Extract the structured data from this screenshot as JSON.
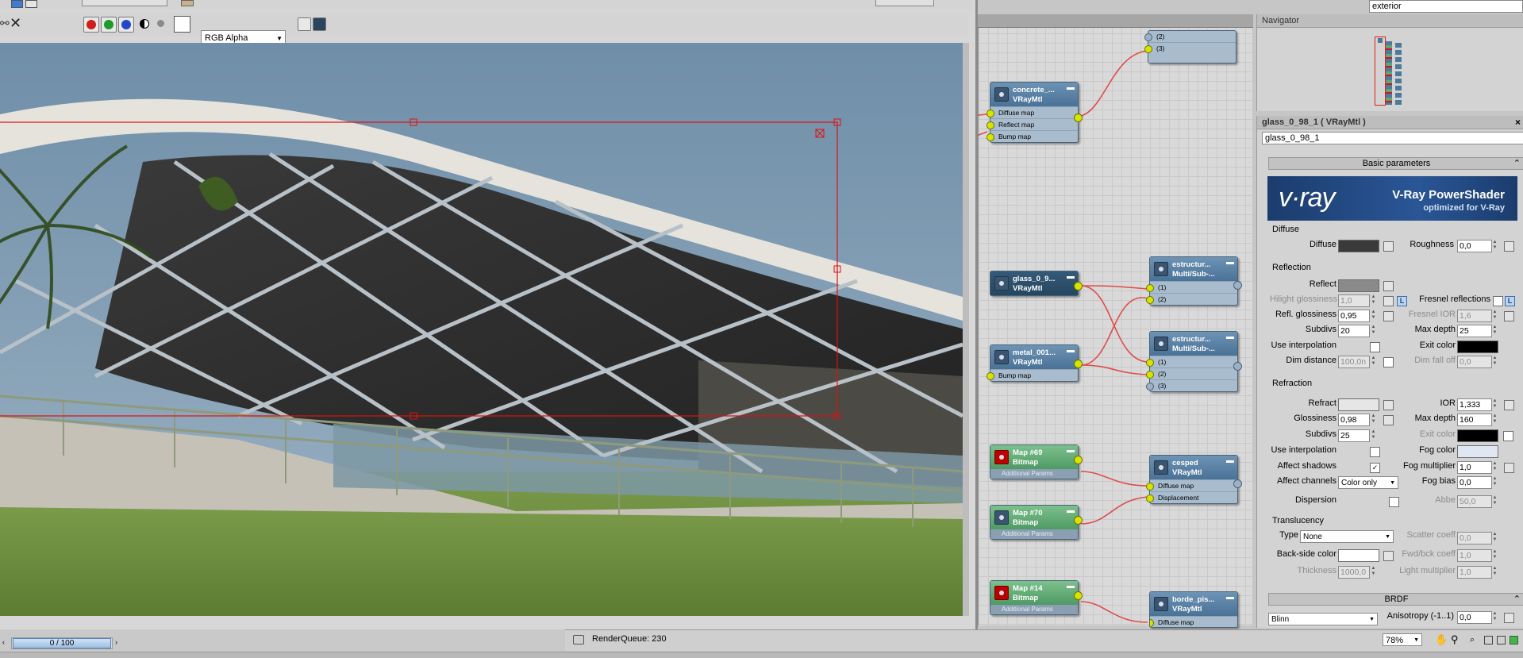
{
  "top_right_dropdown": {
    "value": "exterior"
  },
  "frame_toolbar": {
    "channel_select": "RGB Alpha",
    "colors": {
      "red": "#d11c1c",
      "green": "#1e9c2b",
      "blue": "#2447c9"
    }
  },
  "slate_nodes": [
    {
      "id": "concrete",
      "line1": "concrete_...",
      "line2": "VRayMtl",
      "slots": [
        "Diffuse map",
        "Reflect map",
        "Bump map"
      ]
    },
    {
      "id": "glass",
      "line1": "glass_0_9...",
      "line2": "VRayMtl",
      "slots": []
    },
    {
      "id": "metal",
      "line1": "metal_001...",
      "line2": "VRayMtl",
      "slots": [
        "Bump map"
      ]
    },
    {
      "id": "map69",
      "line1": "Map #69",
      "line2": "Bitmap",
      "extra": "Additional Params"
    },
    {
      "id": "map70",
      "line1": "Map #70",
      "line2": "Bitmap",
      "extra": "Additional Params"
    },
    {
      "id": "map14",
      "line1": "Map #14",
      "line2": "Bitmap",
      "extra": "Additional Params"
    },
    {
      "id": "top",
      "slots": [
        "(2)",
        "(3)"
      ]
    },
    {
      "id": "estruct1",
      "line1": "estructur...",
      "line2": "Multi/Sub-...",
      "slots": [
        "(1)",
        "(2)"
      ]
    },
    {
      "id": "estruct2",
      "line1": "estructur...",
      "line2": "Multi/Sub-...",
      "slots": [
        "(1)",
        "(2)",
        "(3)"
      ]
    },
    {
      "id": "cesped",
      "line1": "cesped",
      "line2": "VRayMtl",
      "slots": [
        "Diffuse map",
        "Displacement"
      ]
    },
    {
      "id": "borde",
      "line1": "borde_pis...",
      "line2": "VRayMtl",
      "slots": [
        "Diffuse map"
      ]
    }
  ],
  "navigator": {
    "title": "Navigator"
  },
  "material": {
    "title": "glass_0_98_1  ( VRayMtl )",
    "name_field": "glass_0_98_1",
    "rollout_basic": "Basic parameters",
    "banner_brand": "v·ray",
    "banner_title": "V-Ray PowerShader",
    "banner_sub": "optimized for V-Ray",
    "diffuse_section": "Diffuse",
    "diffuse_label": "Diffuse",
    "roughness_label": "Roughness",
    "roughness_value": "0,0",
    "reflection_section": "Reflection",
    "reflect_label": "Reflect",
    "hilight_label": "Hilight glossiness",
    "hilight_value": "1,0",
    "fresnel_label": "Fresnel reflections",
    "refl_gloss_label": "Refl. glossiness",
    "refl_gloss_value": "0,95",
    "fresnel_ior_label": "Fresnel IOR",
    "fresnel_ior_value": "1,6",
    "subdivs_label": "Subdivs",
    "refl_subdivs_value": "20",
    "max_depth_label": "Max depth",
    "refl_max_depth_value": "25",
    "use_interp_label": "Use interpolation",
    "exit_color_label": "Exit color",
    "dim_distance_label": "Dim distance",
    "dim_distance_value": "100,0n",
    "dim_falloff_label": "Dim fall off",
    "dim_falloff_value": "0,0",
    "refraction_section": "Refraction",
    "refract_label": "Refract",
    "ior_label": "IOR",
    "ior_value": "1,333",
    "glossiness_label": "Glossiness",
    "glossiness_value": "0,98",
    "refr_max_depth_value": "160",
    "refr_subdivs_value": "25",
    "refr_exit_color_label": "Exit color",
    "fog_color_label": "Fog color",
    "affect_shadows_label": "Affect shadows",
    "fog_multiplier_label": "Fog multiplier",
    "fog_multiplier_value": "1,0",
    "affect_channels_label": "Affect channels",
    "affect_channels_value": "Color only",
    "fog_bias_label": "Fog bias",
    "fog_bias_value": "0,0",
    "dispersion_label": "Dispersion",
    "abbe_label": "Abbe",
    "abbe_value": "50,0",
    "translucency_section": "Translucency",
    "type_label": "Type",
    "type_value": "None",
    "scatter_label": "Scatter coeff",
    "scatter_value": "0,0",
    "backside_label": "Back-side color",
    "fwd_label": "Fwd/bck coeff",
    "fwd_value": "1,0",
    "thickness_label": "Thickness",
    "thickness_value": "1000,0",
    "light_mult_label": "Light multiplier",
    "light_mult_value": "1,0",
    "rollout_brdf": "BRDF",
    "brdf_value": "Blinn",
    "anisotropy_label": "Anisotropy (-1..1)",
    "anisotropy_value": "0,0",
    "colors": {
      "diffuse": "#3a3a3a",
      "reflect": "#8a8a8a",
      "refract": "#e6e6e6",
      "exit": "#000000",
      "fog": "#dfe8f2",
      "backside": "#ffffff"
    }
  },
  "bottom": {
    "timeline": "0 / 100",
    "render_queue": "RenderQueue: 230",
    "zoom": "78%"
  }
}
